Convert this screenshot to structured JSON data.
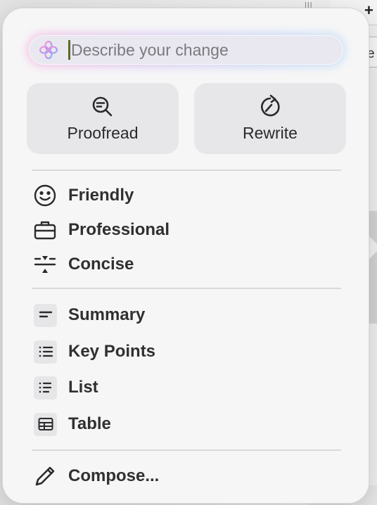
{
  "prompt": {
    "placeholder": "Describe your change"
  },
  "actions": {
    "proofread_label": "Proofread",
    "rewrite_label": "Rewrite"
  },
  "tones": [
    {
      "label": "Friendly",
      "icon": "smiley-icon"
    },
    {
      "label": "Professional",
      "icon": "briefcase-icon"
    },
    {
      "label": "Concise",
      "icon": "compress-icon"
    }
  ],
  "formats": [
    {
      "label": "Summary",
      "icon": "summary-icon"
    },
    {
      "label": "Key Points",
      "icon": "bullet-list-icon"
    },
    {
      "label": "List",
      "icon": "list-icon"
    },
    {
      "label": "Table",
      "icon": "table-icon"
    }
  ],
  "compose": {
    "label": "Compose...",
    "icon": "pencil-icon"
  },
  "background": {
    "partial_text": "e",
    "plus_label": "+"
  },
  "colors": {
    "panel": "#f6f6f7",
    "button": "#e7e7e9",
    "glow_pink": "#f4c2e4",
    "glow_blue": "#c8e0f6",
    "caret": "#5b6b2a"
  }
}
